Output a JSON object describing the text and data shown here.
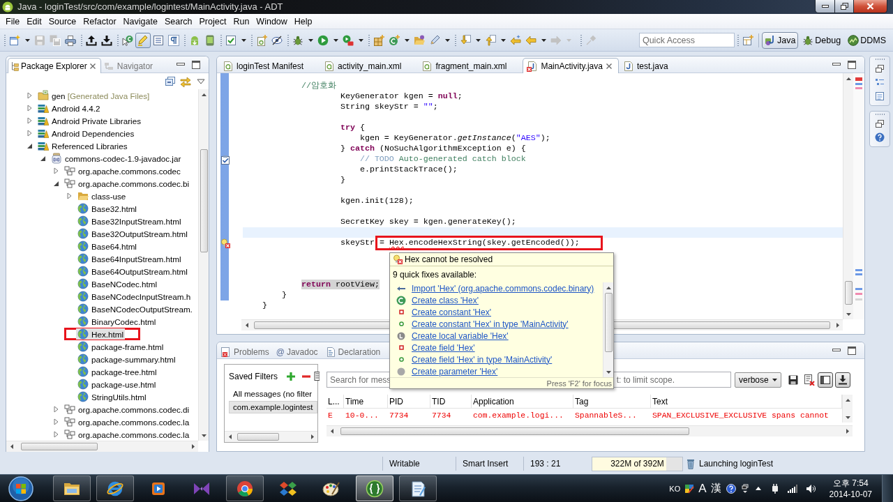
{
  "window": {
    "title": "Java - loginTest/src/com/example/logintest/MainActivity.java - ADT"
  },
  "menu": [
    "File",
    "Edit",
    "Source",
    "Refactor",
    "Navigate",
    "Search",
    "Project",
    "Run",
    "Window",
    "Help"
  ],
  "toolbar": [
    [
      {
        "dropdown": true,
        "disabled": false,
        "pressed": false
      },
      {
        "dropdown": false,
        "disabled": true,
        "pressed": false
      },
      {
        "dropdown": false,
        "disabled": true,
        "pressed": false
      },
      {
        "dropdown": false,
        "disabled": false,
        "pressed": false
      }
    ],
    [
      {
        "dropdown": false,
        "disabled": false,
        "pressed": false
      },
      {
        "dropdown": false,
        "disabled": false,
        "pressed": false
      }
    ],
    [
      {
        "dropdown": false,
        "disabled": false,
        "pressed": false
      },
      {
        "dropdown": false,
        "disabled": false,
        "pressed": true
      },
      {
        "dropdown": false,
        "disabled": false,
        "pressed": false
      },
      {
        "dropdown": false,
        "disabled": false,
        "pressed": false
      }
    ],
    [
      {
        "dropdown": false,
        "disabled": false,
        "pressed": false
      },
      {
        "dropdown": false,
        "disabled": false,
        "pressed": false
      }
    ],
    [
      {
        "dropdown": true,
        "disabled": false,
        "pressed": false
      }
    ],
    [
      {
        "dropdown": false,
        "disabled": false,
        "pressed": false
      },
      {
        "dropdown": false,
        "disabled": false,
        "pressed": false
      }
    ],
    [
      {
        "dropdown": true,
        "disabled": false,
        "pressed": false
      },
      {
        "dropdown": true,
        "disabled": false,
        "pressed": false
      },
      {
        "dropdown": true,
        "disabled": false,
        "pressed": false
      }
    ],
    [
      {
        "dropdown": false,
        "disabled": false,
        "pressed": false
      },
      {
        "dropdown": true,
        "disabled": false,
        "pressed": false
      },
      {
        "dropdown": false,
        "disabled": false,
        "pressed": false
      },
      {
        "dropdown": true,
        "disabled": false,
        "pressed": false
      }
    ],
    [
      {
        "dropdown": true,
        "disabled": false,
        "pressed": false
      },
      {
        "dropdown": true,
        "disabled": false,
        "pressed": false
      },
      {
        "dropdown": false,
        "disabled": false,
        "pressed": false
      },
      {
        "dropdown": true,
        "disabled": false,
        "pressed": false
      },
      {
        "dropdown": true,
        "disabled": true,
        "pressed": false
      }
    ],
    [
      {
        "dropdown": false,
        "disabled": true,
        "pressed": false
      }
    ]
  ],
  "quick_access": {
    "placeholder": "Quick Access"
  },
  "perspectives": [
    {
      "label": "Java",
      "selected": true
    },
    {
      "label": "Debug",
      "selected": false
    },
    {
      "label": "DDMS",
      "selected": false
    }
  ],
  "explorer": {
    "tabs": [
      {
        "label": "Package Explorer",
        "selected": true
      },
      {
        "label": "Navigator",
        "selected": false
      }
    ],
    "tree": [
      {
        "label": "gen",
        "decoration": "[Generated Java Files]",
        "kind": "source-folder",
        "expanded": false,
        "selected": false,
        "framed": false
      },
      {
        "label": "Android 4.4.2",
        "kind": "library",
        "expanded": false,
        "selected": false,
        "framed": false
      },
      {
        "label": "Android Private Libraries",
        "kind": "library",
        "expanded": false,
        "selected": false,
        "framed": false
      },
      {
        "label": "Android Dependencies",
        "kind": "library",
        "expanded": false,
        "selected": false,
        "framed": false
      },
      {
        "label": "Referenced Libraries",
        "kind": "library",
        "expanded": true,
        "selected": false,
        "framed": false,
        "children": [
          {
            "label": "commons-codec-1.9-javadoc.jar",
            "kind": "jar",
            "expanded": true,
            "selected": false,
            "framed": false,
            "children": [
              {
                "label": "org.apache.commons.codec",
                "kind": "package",
                "expanded": false,
                "selected": false,
                "framed": false
              },
              {
                "label": "org.apache.commons.codec.bi",
                "kind": "package",
                "expanded": true,
                "selected": false,
                "framed": false,
                "children": [
                  {
                    "label": "class-use",
                    "kind": "folder",
                    "expanded": false,
                    "selected": false,
                    "framed": false
                  },
                  {
                    "label": "Base32.html",
                    "kind": "file",
                    "selected": false,
                    "framed": false
                  },
                  {
                    "label": "Base32InputStream.html",
                    "kind": "file",
                    "selected": false,
                    "framed": false
                  },
                  {
                    "label": "Base32OutputStream.html",
                    "kind": "file",
                    "selected": false,
                    "framed": false
                  },
                  {
                    "label": "Base64.html",
                    "kind": "file",
                    "selected": false,
                    "framed": false
                  },
                  {
                    "label": "Base64InputStream.html",
                    "kind": "file",
                    "selected": false,
                    "framed": false
                  },
                  {
                    "label": "Base64OutputStream.html",
                    "kind": "file",
                    "selected": false,
                    "framed": false
                  },
                  {
                    "label": "BaseNCodec.html",
                    "kind": "file",
                    "selected": false,
                    "framed": false
                  },
                  {
                    "label": "BaseNCodecInputStream.h",
                    "kind": "file",
                    "selected": false,
                    "framed": false
                  },
                  {
                    "label": "BaseNCodecOutputStream.",
                    "kind": "file",
                    "selected": false,
                    "framed": false
                  },
                  {
                    "label": "BinaryCodec.html",
                    "kind": "file",
                    "selected": false,
                    "framed": false
                  },
                  {
                    "label": "Hex.html",
                    "kind": "file",
                    "selected": true,
                    "framed": true
                  },
                  {
                    "label": "package-frame.html",
                    "kind": "file",
                    "selected": false,
                    "framed": false
                  },
                  {
                    "label": "package-summary.html",
                    "kind": "file",
                    "selected": false,
                    "framed": false
                  },
                  {
                    "label": "package-tree.html",
                    "kind": "file",
                    "selected": false,
                    "framed": false
                  },
                  {
                    "label": "package-use.html",
                    "kind": "file",
                    "selected": false,
                    "framed": false
                  },
                  {
                    "label": "StringUtils.html",
                    "kind": "file",
                    "selected": false,
                    "framed": false
                  }
                ]
              },
              {
                "label": "org.apache.commons.codec.di",
                "kind": "package",
                "expanded": false,
                "selected": false,
                "framed": false
              },
              {
                "label": "org.apache.commons.codec.la",
                "kind": "package",
                "expanded": false,
                "selected": false,
                "framed": false
              },
              {
                "label": "org.apache.commons.codec.la",
                "kind": "package",
                "expanded": false,
                "selected": false,
                "framed": false
              }
            ]
          }
        ]
      }
    ]
  },
  "editor": {
    "tabs": [
      {
        "label": "loginTest Manifest",
        "kind": "manifest",
        "selected": false,
        "error": false
      },
      {
        "label": "activity_main.xml",
        "kind": "xml",
        "selected": false,
        "error": false
      },
      {
        "label": "fragment_main.xml",
        "kind": "xml",
        "selected": false,
        "error": false
      },
      {
        "label": "MainActivity.java",
        "kind": "java",
        "selected": true,
        "error": true
      },
      {
        "label": "test.java",
        "kind": "java",
        "selected": false,
        "error": false
      }
    ],
    "lines": [
      {
        "current": false,
        "segments": [
          {
            "kind": "comment",
            "text": "            //암호화"
          }
        ]
      },
      {
        "current": false,
        "segments": [
          {
            "kind": "plain",
            "text": "                    KeyGenerator kgen = "
          },
          {
            "kind": "keyword",
            "text": "null"
          },
          {
            "kind": "plain",
            "text": ";"
          }
        ]
      },
      {
        "current": false,
        "segments": [
          {
            "kind": "plain",
            "text": "                    String skeyStr = "
          },
          {
            "kind": "string",
            "text": "\"\""
          },
          {
            "kind": "plain",
            "text": ";"
          }
        ]
      },
      {
        "current": false
      },
      {
        "current": false,
        "segments": [
          {
            "kind": "keyword",
            "text": "                    try"
          },
          {
            "kind": "plain",
            "text": " {"
          }
        ]
      },
      {
        "current": false,
        "segments": [
          {
            "kind": "plain",
            "text": "                        kgen = KeyGenerator."
          },
          {
            "kind": "static",
            "text": "getInstance"
          },
          {
            "kind": "plain",
            "text": "("
          },
          {
            "kind": "string",
            "text": "\"AES\""
          },
          {
            "kind": "plain",
            "text": ");"
          }
        ]
      },
      {
        "current": false,
        "segments": [
          {
            "kind": "plain",
            "text": "                    } "
          },
          {
            "kind": "keyword",
            "text": "catch"
          },
          {
            "kind": "plain",
            "text": " (NoSuchAlgorithmException e) {"
          }
        ]
      },
      {
        "current": false,
        "marker": {
          "kind": "task"
        },
        "segments": [
          {
            "kind": "todo",
            "text": "                        // TODO"
          },
          {
            "kind": "comment",
            "text": " Auto-generated catch block"
          }
        ]
      },
      {
        "current": false,
        "segments": [
          {
            "kind": "plain",
            "text": "                        e.printStackTrace();"
          }
        ]
      },
      {
        "current": false,
        "segments": [
          {
            "kind": "plain",
            "text": "                    }"
          }
        ]
      },
      {
        "current": false
      },
      {
        "current": false,
        "segments": [
          {
            "kind": "plain",
            "text": "                    kgen.init(128);"
          }
        ]
      },
      {
        "current": false
      },
      {
        "current": false,
        "segments": [
          {
            "kind": "plain",
            "text": "                    SecretKey skey = kgen.generateKey();"
          }
        ]
      },
      {
        "current": true
      },
      {
        "current": false,
        "marker": {
          "kind": "error"
        },
        "segments": [
          {
            "kind": "plain",
            "text": "                    skeyStr ",
            "framed": false
          },
          {
            "kind": "plain",
            "text": "= ",
            "framed": true
          },
          {
            "kind": "error",
            "text": "Hex",
            "framed": true
          },
          {
            "kind": "plain",
            "text": ".encodeHexString(skey.getEncoded());",
            "framed": true
          }
        ]
      },
      {
        "current": false
      },
      {
        "current": false
      },
      {
        "current": false
      },
      {
        "current": false,
        "segments": [
          {
            "kind": "keyword",
            "text": "            return",
            "marked": true
          },
          {
            "kind": "plain",
            "text": " rootView;",
            "marked": true
          }
        ]
      },
      {
        "current": false,
        "segments": [
          {
            "kind": "plain",
            "text": "        }"
          }
        ]
      },
      {
        "current": false,
        "segments": [
          {
            "kind": "plain",
            "text": "    }"
          }
        ]
      }
    ]
  },
  "quick_fix": {
    "problem": "Hex cannot be resolved",
    "summary": "9 quick fixes available:",
    "fixes": [
      {
        "label": "Import 'Hex' (org.apache.commons.codec.binary)",
        "kind": "import"
      },
      {
        "label": "Create class 'Hex'",
        "kind": "class"
      },
      {
        "label": "Create constant 'Hex'",
        "kind": "private"
      },
      {
        "label": "Create constant 'Hex' in type 'MainActivity'",
        "kind": "public"
      },
      {
        "label": "Create local variable 'Hex'",
        "kind": "local"
      },
      {
        "label": "Create field 'Hex'",
        "kind": "private"
      },
      {
        "label": "Create field 'Hex' in type 'MainActivity'",
        "kind": "public"
      },
      {
        "label": "Create parameter 'Hex'",
        "kind": "parameter"
      }
    ],
    "hint": "Press 'F2' for focus"
  },
  "console": {
    "tabs": [
      {
        "label": "Problems",
        "selected": false
      },
      {
        "label": "Javadoc",
        "glyph": "@",
        "selected": false
      },
      {
        "label": "Declaration",
        "selected": false
      }
    ],
    "filters": {
      "title": "Saved Filters",
      "items": [
        {
          "label": "All messages (no filter",
          "selected": false
        },
        {
          "label": "com.example.logintest",
          "selected": true
        }
      ]
    },
    "search": {
      "placeholder_start": "Search for mess",
      "placeholder_end": "t: to limit scope."
    },
    "log_level": "verbose",
    "toggles": [
      {
        "pressed": false
      },
      {
        "pressed": false
      },
      {
        "pressed": true
      },
      {
        "pressed": true
      }
    ],
    "table": {
      "columns": [
        "L...",
        "Time",
        "PID",
        "TID",
        "Application",
        "Tag",
        "Text"
      ],
      "rows": [
        {
          "color": "#ee0000",
          "cells": [
            "E",
            "10-0...",
            "7734",
            "7734",
            "com.example.logi...",
            "SpannableS...",
            "SPAN_EXCLUSIVE_EXCLUSIVE spans cannot"
          ]
        }
      ]
    }
  },
  "status_bar": {
    "mode": "Writable",
    "insert": "Smart Insert",
    "position": "193 : 21",
    "heap": {
      "text": "322M of 392M",
      "level": 0.82
    },
    "job": "Launching loginTest"
  },
  "taskbar": {
    "apps": [
      {
        "running": true,
        "active": false
      },
      {
        "running": true,
        "active": false
      },
      {
        "running": false,
        "active": false
      },
      {
        "running": false,
        "active": false
      },
      {
        "running": true,
        "active": false
      },
      {
        "running": false,
        "active": false
      },
      {
        "running": false,
        "active": false
      },
      {
        "running": true,
        "active": true
      },
      {
        "running": true,
        "active": false
      }
    ],
    "tray": {
      "language": "KO",
      "ime_mode": "A",
      "hanja": "漢"
    },
    "clock": {
      "time": "오후 7:54",
      "date": "2014-10-07"
    }
  }
}
